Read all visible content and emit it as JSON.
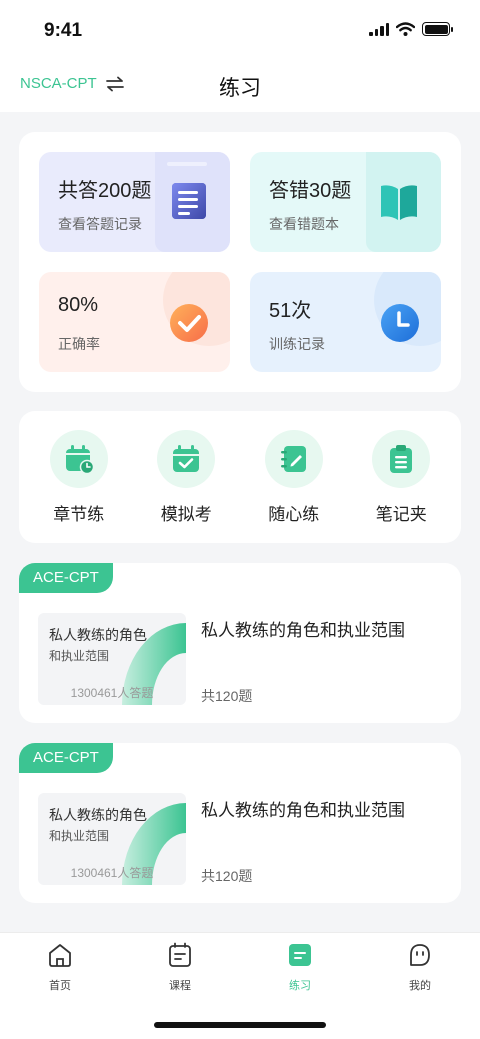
{
  "status_bar": {
    "time": "9:41"
  },
  "header": {
    "exam_switch": "NSCA-CPT",
    "title": "练习"
  },
  "stats": [
    {
      "value": "共答200题",
      "label": "查看答题记录",
      "icon": "document-icon"
    },
    {
      "value": "答错30题",
      "label": "查看错题本",
      "icon": "open-book-icon"
    },
    {
      "value": "80%",
      "label": "正确率",
      "icon": "check-circle-icon"
    },
    {
      "value": "51次",
      "label": "训练记录",
      "icon": "clock-icon"
    }
  ],
  "tools": [
    {
      "label": "章节练",
      "icon": "calendar-clock-icon"
    },
    {
      "label": "模拟考",
      "icon": "calendar-check-icon"
    },
    {
      "label": "随心练",
      "icon": "notebook-pen-icon"
    },
    {
      "label": "笔记夹",
      "icon": "clipboard-icon"
    }
  ],
  "courses": [
    {
      "tag": "ACE-CPT",
      "thumb_title": "私人教练的角色",
      "thumb_subtitle": "和执业范围",
      "thumb_count": "1300461人答题",
      "name": "私人教练的角色和执业范围",
      "total": "共120题"
    },
    {
      "tag": "ACE-CPT",
      "thumb_title": "私人教练的角色",
      "thumb_subtitle": "和执业范围",
      "thumb_count": "1300461人答题",
      "name": "私人教练的角色和执业范围",
      "total": "共120题"
    }
  ],
  "tabbar": {
    "active": "练习",
    "items": [
      {
        "label": "首页",
        "icon": "home-icon"
      },
      {
        "label": "课程",
        "icon": "course-icon"
      },
      {
        "label": "练习",
        "icon": "practice-icon"
      },
      {
        "label": "我的",
        "icon": "profile-icon"
      }
    ]
  },
  "colors": {
    "accent": "#3cc492",
    "page_bg": "#f4f5f7"
  }
}
